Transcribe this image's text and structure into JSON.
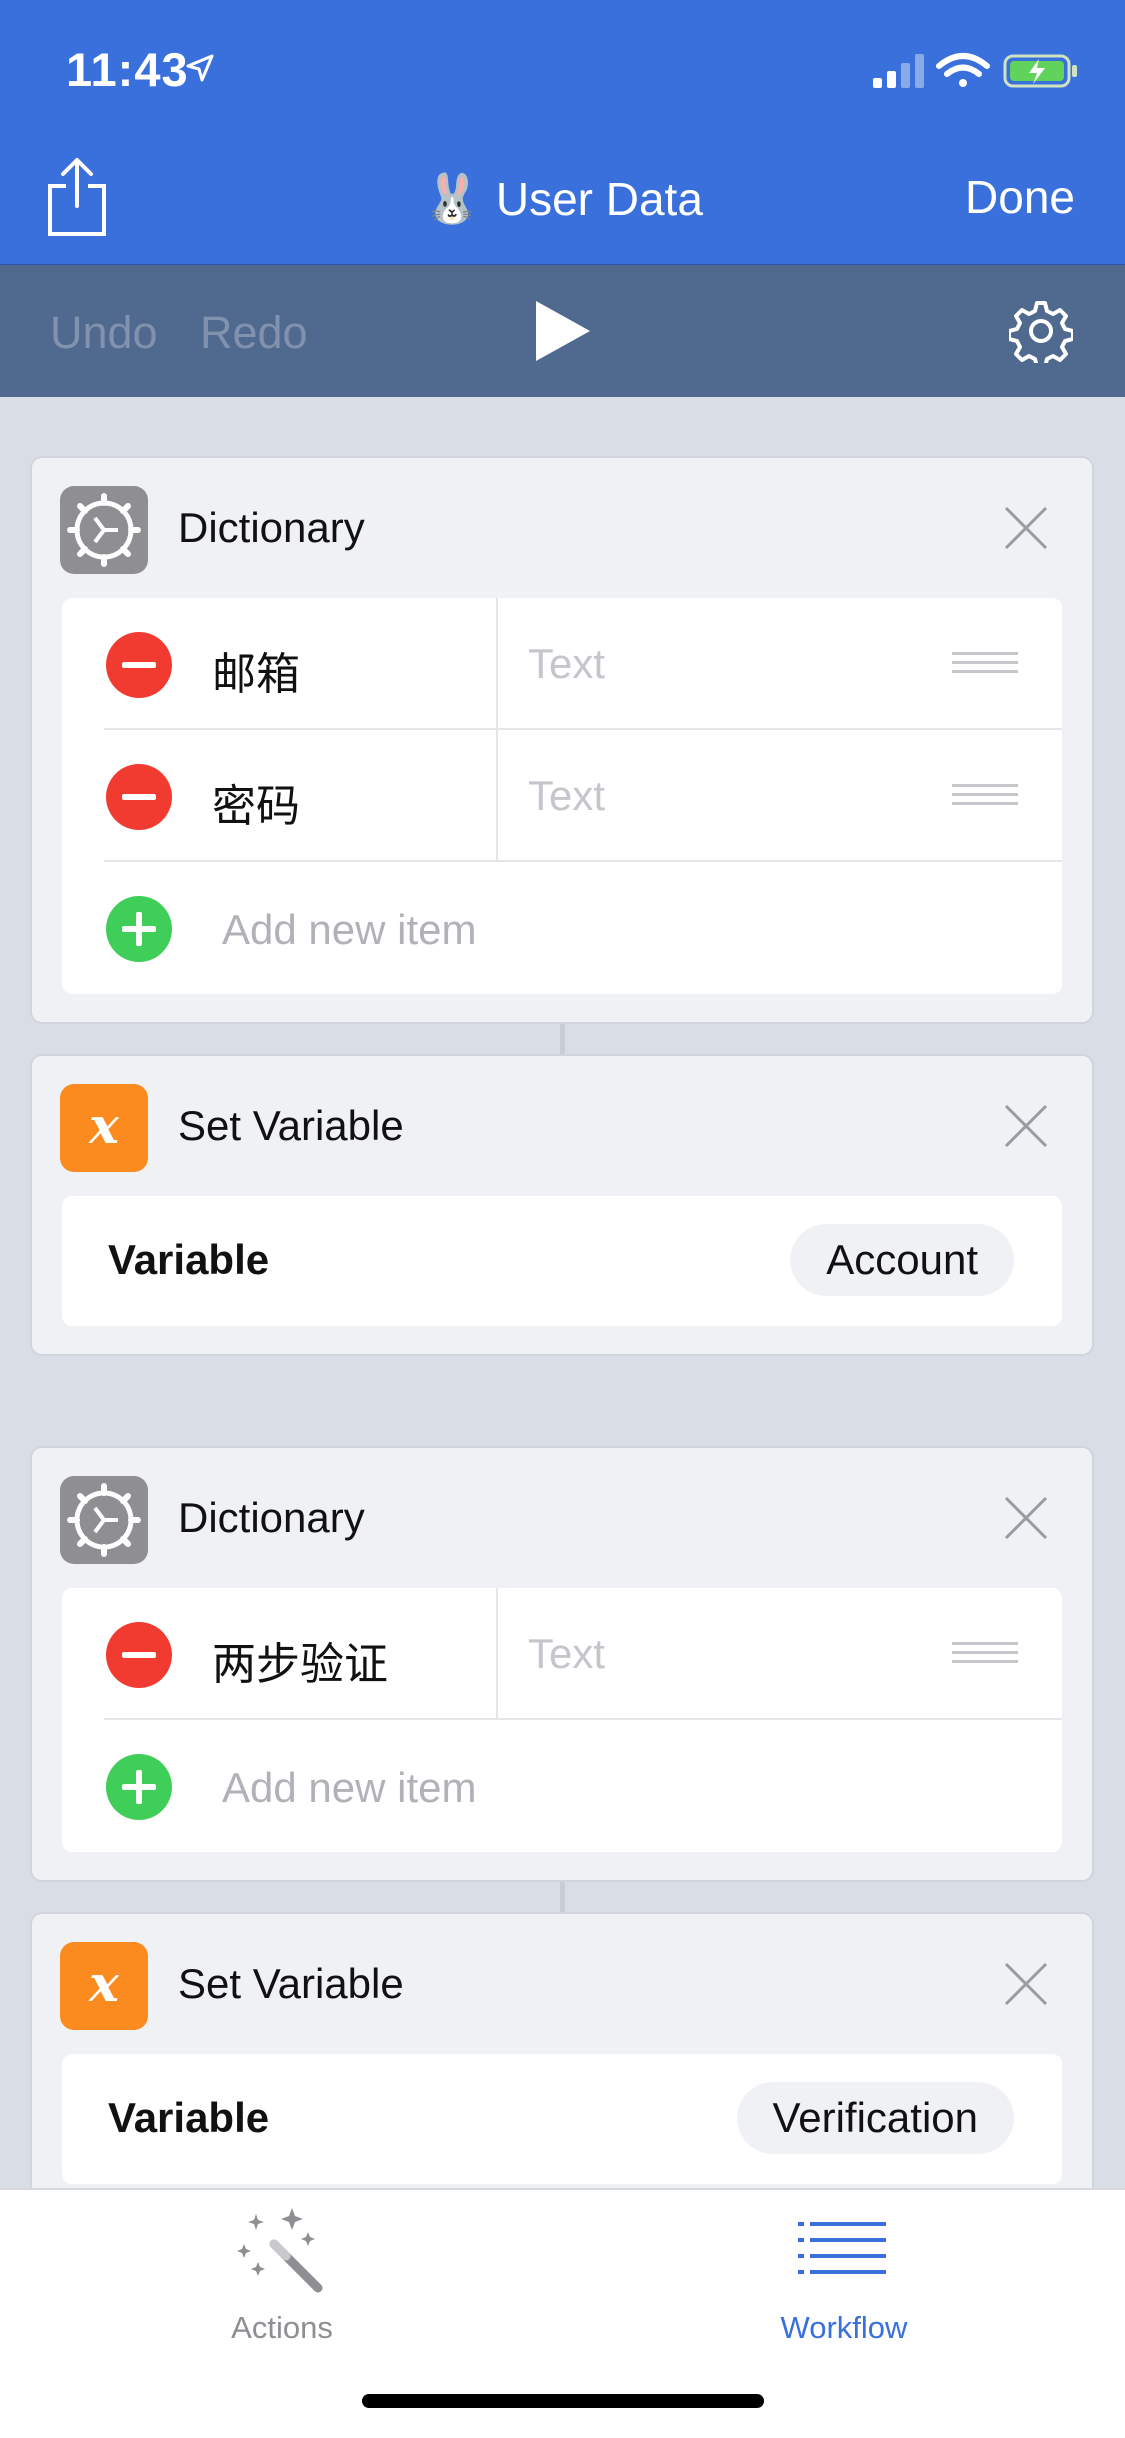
{
  "status_bar": {
    "time": "11:43"
  },
  "nav": {
    "title": "User Data",
    "emoji": "🐰",
    "done_label": "Done"
  },
  "toolbar": {
    "undo_label": "Undo",
    "redo_label": "Redo"
  },
  "actions": [
    {
      "type": "dictionary",
      "title": "Dictionary",
      "items": [
        {
          "key": "邮箱",
          "value_placeholder": "Text"
        },
        {
          "key": "密码",
          "value_placeholder": "Text"
        }
      ],
      "add_label": "Add new item"
    },
    {
      "type": "set_variable",
      "title": "Set Variable",
      "icon_letter": "x",
      "field_label": "Variable",
      "value": "Account"
    },
    {
      "type": "dictionary",
      "title": "Dictionary",
      "items": [
        {
          "key": "两步验证",
          "value_placeholder": "Text"
        }
      ],
      "add_label": "Add new item"
    },
    {
      "type": "set_variable",
      "title": "Set Variable",
      "icon_letter": "x",
      "field_label": "Variable",
      "value": "Verification"
    }
  ],
  "tabbar": {
    "tabs": [
      {
        "label": "Actions",
        "icon": "magic-wand-icon",
        "selected": false,
        "color": "#8e8e93"
      },
      {
        "label": "Workflow",
        "icon": "list-icon",
        "selected": true,
        "color": "#3a70dc"
      }
    ]
  },
  "colors": {
    "header": "#3a70dc",
    "toolbar": "#50698e",
    "delete": "#f23b30",
    "add": "#3fcf59",
    "variable_icon": "#fb8b1e"
  }
}
